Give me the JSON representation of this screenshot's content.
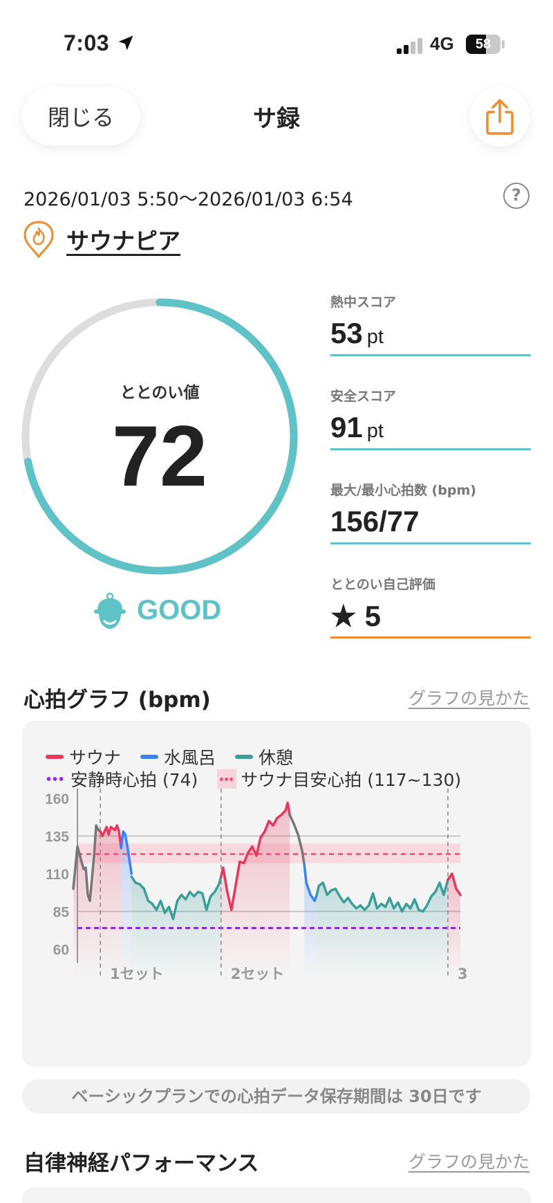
{
  "status": {
    "time": "7:03",
    "network": "4G",
    "battery": "58",
    "battery_level": 0.58
  },
  "header": {
    "close_label": "閉じる",
    "title": "サ録",
    "share_icon": "share-icon"
  },
  "session": {
    "date_range": "2026/01/03 5:50～2026/01/03 6:54",
    "facility": "サウナピア"
  },
  "gauge": {
    "label": "ととのい値",
    "value": "72",
    "max": 100,
    "rating": "GOOD",
    "accent": "#5ec2c6",
    "track": "#dddddd"
  },
  "scores": [
    {
      "label": "熱中スコア",
      "value": "53",
      "unit": "pt"
    },
    {
      "label": "安全スコア",
      "value": "91",
      "unit": "pt"
    },
    {
      "label": "最大/最小心拍数 (bpm)",
      "value": "156/77",
      "unit": ""
    },
    {
      "label": "ととのい自己評価",
      "value": "5",
      "unit": "",
      "star": "★"
    }
  ],
  "heart_graph": {
    "title": "心拍グラフ (bpm)",
    "help_link": "グラフの見かた",
    "legend": {
      "sauna": "サウナ",
      "water": "水風呂",
      "rest": "休憩",
      "resting_hr": "安静時心拍 (74)",
      "target_hr": "サウナ目安心拍 (117~130)"
    },
    "colors": {
      "sauna": "#e8365d",
      "water": "#3b82f6",
      "rest": "#3a9f9a",
      "transition": "#777777",
      "resting_line": "#8a2be2",
      "target": "#ec4a72"
    }
  },
  "chart_data": {
    "type": "line",
    "ylim": [
      60,
      160
    ],
    "y_ticks": [
      60,
      85,
      110,
      135,
      160
    ],
    "resting_hr": 74,
    "target_range": [
      117,
      130
    ],
    "target_line": 123,
    "set_labels": [
      "1セット",
      "2セット",
      "3"
    ],
    "series": [
      {
        "name": "サウナ",
        "phase": "sauna",
        "points": [
          [
            0.09,
            100
          ],
          [
            0.1,
            128
          ],
          [
            0.115,
            113
          ],
          [
            0.12,
            114
          ],
          [
            0.125,
            96
          ],
          [
            0.13,
            92
          ],
          [
            0.14,
            122
          ],
          [
            0.145,
            142
          ],
          [
            0.15,
            139
          ],
          [
            0.155,
            138
          ]
        ]
      },
      {
        "name": "サウナ",
        "phase": "sauna",
        "points": [
          [
            0.155,
            138
          ],
          [
            0.16,
            135
          ],
          [
            0.17,
            141
          ],
          [
            0.175,
            136
          ],
          [
            0.18,
            141
          ],
          [
            0.19,
            139
          ],
          [
            0.195,
            142
          ],
          [
            0.2,
            138
          ],
          [
            0.205,
            127
          ]
        ]
      },
      {
        "name": "水風呂",
        "phase": "water",
        "points": [
          [
            0.205,
            127
          ],
          [
            0.21,
            138
          ],
          [
            0.215,
            136
          ],
          [
            0.22,
            128
          ],
          [
            0.23,
            110
          ]
        ]
      },
      {
        "name": "休憩",
        "phase": "rest",
        "points": [
          [
            0.23,
            108
          ],
          [
            0.24,
            104
          ],
          [
            0.25,
            103
          ],
          [
            0.26,
            100
          ],
          [
            0.27,
            92
          ],
          [
            0.28,
            90
          ],
          [
            0.29,
            86
          ],
          [
            0.3,
            92
          ],
          [
            0.31,
            84
          ],
          [
            0.32,
            88
          ],
          [
            0.33,
            80
          ],
          [
            0.34,
            92
          ],
          [
            0.35,
            96
          ],
          [
            0.36,
            93
          ],
          [
            0.37,
            98
          ],
          [
            0.38,
            95
          ],
          [
            0.39,
            98
          ],
          [
            0.4,
            97
          ],
          [
            0.41,
            86
          ],
          [
            0.42,
            95
          ],
          [
            0.43,
            98
          ],
          [
            0.44,
            103
          ],
          [
            0.445,
            108
          ]
        ]
      },
      {
        "name": "サウナ",
        "phase": "sauna",
        "points": [
          [
            0.445,
            108
          ],
          [
            0.45,
            114
          ],
          [
            0.46,
            98
          ],
          [
            0.47,
            86
          ],
          [
            0.48,
            102
          ],
          [
            0.49,
            118
          ],
          [
            0.5,
            117
          ],
          [
            0.51,
            124
          ],
          [
            0.52,
            128
          ],
          [
            0.53,
            122
          ],
          [
            0.54,
            134
          ],
          [
            0.55,
            138
          ],
          [
            0.56,
            145
          ],
          [
            0.57,
            142
          ],
          [
            0.58,
            147
          ],
          [
            0.59,
            149
          ],
          [
            0.6,
            152
          ],
          [
            0.605,
            157
          ],
          [
            0.61,
            149
          ]
        ]
      },
      {
        "name": "休憩",
        "phase": "transition",
        "points": [
          [
            0.61,
            149
          ],
          [
            0.62,
            143
          ],
          [
            0.63,
            136
          ],
          [
            0.64,
            125
          ],
          [
            0.645,
            116
          ]
        ]
      },
      {
        "name": "水風呂",
        "phase": "water",
        "points": [
          [
            0.645,
            116
          ],
          [
            0.65,
            104
          ],
          [
            0.66,
            96
          ],
          [
            0.67,
            92
          ],
          [
            0.675,
            96
          ]
        ]
      },
      {
        "name": "休憩",
        "phase": "rest",
        "points": [
          [
            0.675,
            96
          ],
          [
            0.68,
            102
          ],
          [
            0.69,
            104
          ],
          [
            0.7,
            96
          ],
          [
            0.71,
            99
          ],
          [
            0.72,
            100
          ],
          [
            0.73,
            95
          ],
          [
            0.74,
            91
          ],
          [
            0.75,
            94
          ],
          [
            0.76,
            90
          ],
          [
            0.77,
            87
          ],
          [
            0.78,
            89
          ],
          [
            0.79,
            86
          ],
          [
            0.8,
            89
          ],
          [
            0.81,
            97
          ],
          [
            0.82,
            87
          ],
          [
            0.83,
            90
          ],
          [
            0.84,
            88
          ],
          [
            0.85,
            94
          ],
          [
            0.86,
            87
          ],
          [
            0.87,
            91
          ],
          [
            0.88,
            85
          ],
          [
            0.89,
            90
          ],
          [
            0.9,
            87
          ],
          [
            0.91,
            93
          ],
          [
            0.92,
            86
          ],
          [
            0.93,
            85
          ],
          [
            0.94,
            89
          ],
          [
            0.95,
            95
          ],
          [
            0.96,
            98
          ],
          [
            0.97,
            104
          ],
          [
            0.98,
            96
          ],
          [
            0.99,
            106
          ]
        ]
      },
      {
        "name": "サウナ",
        "phase": "sauna",
        "points": [
          [
            0.99,
            106
          ],
          [
            1.0,
            110
          ],
          [
            1.01,
            100
          ],
          [
            1.02,
            96
          ]
        ]
      }
    ]
  },
  "notice": "ベーシックプランでの心拍データ保存期間は 30日です",
  "autonomic": {
    "title": "自律神経パフォーマンス",
    "help_link": "グラフの見かた"
  }
}
